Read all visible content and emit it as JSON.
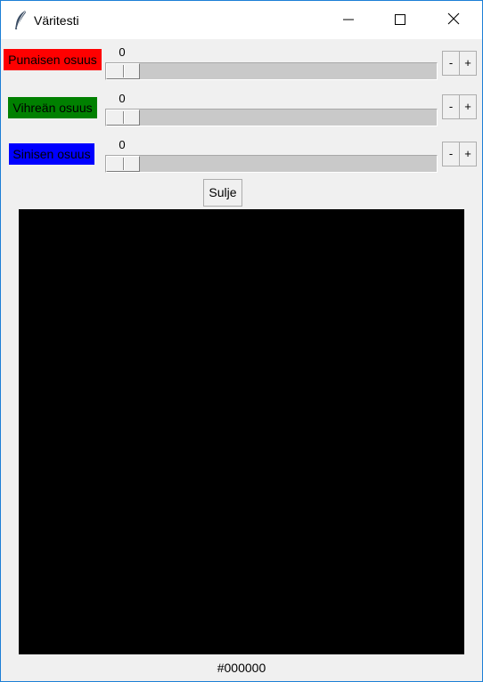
{
  "window": {
    "title": "Väritesti",
    "icon": "feather-icon",
    "controls": [
      "minimize-icon",
      "maximize-icon",
      "close-icon"
    ]
  },
  "sliders": [
    {
      "label": "Punaisen osuus",
      "label_color": "#ff0000",
      "value": "0",
      "minus": "-",
      "plus": "+"
    },
    {
      "label": "Vihreän osuus",
      "label_color": "#008000",
      "value": "0",
      "minus": "-",
      "plus": "+"
    },
    {
      "label": "Sinisen osuus",
      "label_color": "#0000ff",
      "value": "0",
      "minus": "-",
      "plus": "+"
    }
  ],
  "close_button": "Sulje",
  "preview": {
    "color": "#000000",
    "hex": "#000000"
  }
}
